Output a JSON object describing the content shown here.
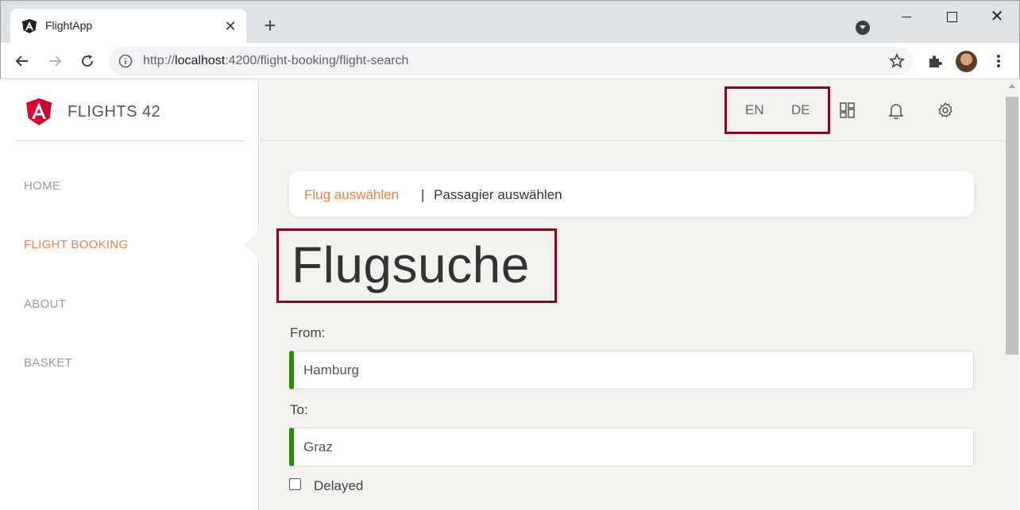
{
  "browser": {
    "tab_title": "FlightApp",
    "tab_close": "✕",
    "new_tab": "+",
    "url_prefix": "http://",
    "url_host": "localhost",
    "url_path": ":4200/flight-booking/flight-search",
    "win_close": "✕"
  },
  "sidebar": {
    "brand": "FLIGHTS 42",
    "items": [
      {
        "label": "HOME"
      },
      {
        "label": "FLIGHT BOOKING"
      },
      {
        "label": "ABOUT"
      },
      {
        "label": "BASKET"
      }
    ]
  },
  "topbar": {
    "lang_en": "EN",
    "lang_de": "DE"
  },
  "breadcrumb": {
    "link": "Flug auswählen",
    "separator": "|",
    "current": "Passagier auswählen"
  },
  "main": {
    "title": "Flugsuche",
    "from_label": "From:",
    "from_value": "Hamburg",
    "to_label": "To:",
    "to_value": "Graz",
    "delayed_label": "Delayed"
  },
  "colors": {
    "accent": "#e8814f",
    "highlight_border": "#7d0a1f",
    "valid_green": "#2e8b0a",
    "angular_red": "#dd0031"
  }
}
